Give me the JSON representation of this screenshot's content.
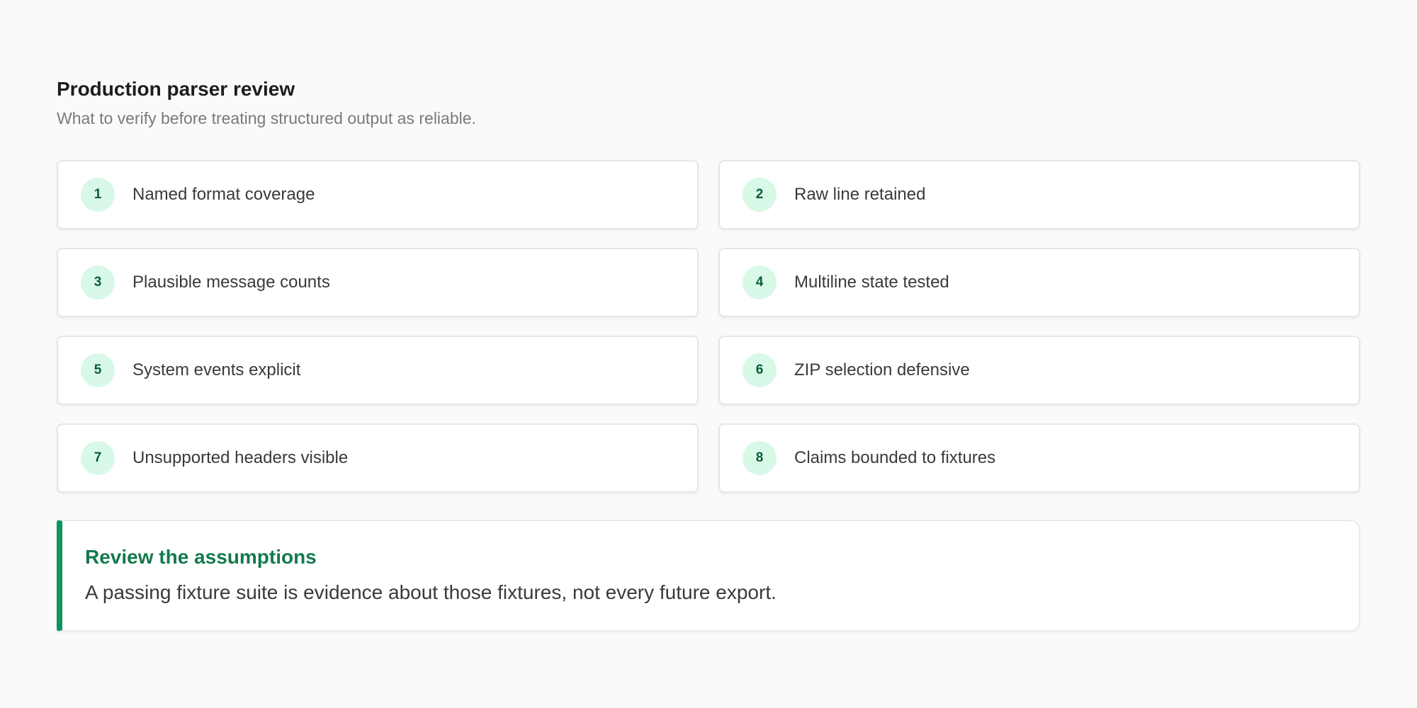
{
  "header": {
    "title": "Production parser review",
    "subtitle": "What to verify before treating structured output as reliable."
  },
  "checklist": [
    {
      "number": "1",
      "label": "Named format coverage"
    },
    {
      "number": "2",
      "label": "Raw line retained"
    },
    {
      "number": "3",
      "label": "Plausible message counts"
    },
    {
      "number": "4",
      "label": "Multiline state tested"
    },
    {
      "number": "5",
      "label": "System events explicit"
    },
    {
      "number": "6",
      "label": "ZIP selection defensive"
    },
    {
      "number": "7",
      "label": "Unsupported headers visible"
    },
    {
      "number": "8",
      "label": "Claims bounded to fixtures"
    }
  ],
  "callout": {
    "title": "Review the assumptions",
    "body": "A passing fixture suite is evidence about those fixtures, not every future export."
  },
  "colors": {
    "accent": "#0f9460",
    "badge_background": "#d9f9e8",
    "badge_text": "#0b5e38",
    "callout_title": "#137a4d"
  }
}
